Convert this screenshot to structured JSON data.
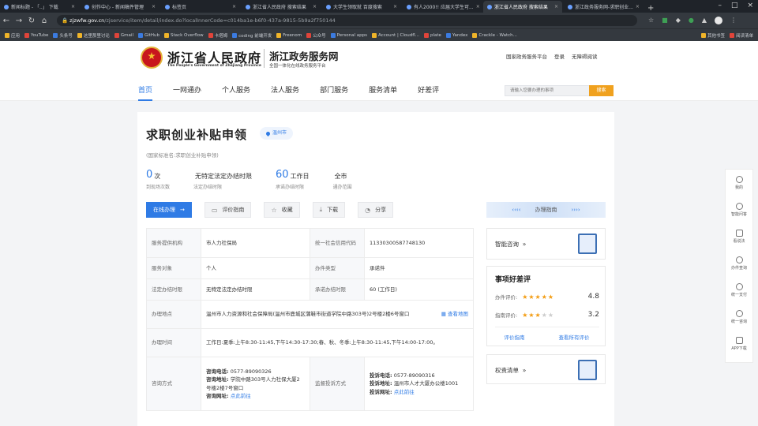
{
  "browser": {
    "tabs": [
      {
        "label": "新闻标题 - 「..」 下载"
      },
      {
        "label": "创作中心 - 新闻稿件管理"
      },
      {
        "label": "标签页"
      },
      {
        "label": "浙江省人民政府 搜索结果"
      },
      {
        "label": "大学生领取就 百度搜索"
      },
      {
        "label": "有人2000!! 应届大学生可..."
      },
      {
        "label": "浙江省人民政府 搜索结果"
      },
      {
        "label": "浙江政务服务网-求职创业..."
      }
    ],
    "active_tab": 6,
    "url_domain": "zjzwfw.gov.cn",
    "url_path": "/zjservice/item/detail/index.do?localInnerCode=c014ba1e-b6f0-437a-9815-5b9a2f750144",
    "bookmarks": [
      "应用",
      "YouTube",
      "头条号",
      "这里那里讨论",
      "Gmail",
      "GitHub",
      "Stack Overflow",
      "卡塔姆",
      "coding 前端开发",
      "Freenom",
      "公众号",
      "Personal apps",
      "Account | Cloudfl...",
      "plate",
      "Yandex",
      "Crackle - Watch..."
    ],
    "bookmarks_right": [
      "其他书签",
      "阅读清单"
    ]
  },
  "header": {
    "gov_title": "浙江省人民政府",
    "gov_en": "The People's Government of Zhejiang Province",
    "service_title": "浙江政务服务网",
    "service_sub": "全国一体化在线政务服务平台",
    "top_links": [
      "国家政务服务平台",
      "登录",
      "无障碍阅读"
    ],
    "nav": [
      "首页",
      "一网通办",
      "个人服务",
      "法人服务",
      "部门服务",
      "服务清单",
      "好差评"
    ],
    "search_placeholder": "请输入您要办理的事项",
    "search_button": "搜索"
  },
  "item": {
    "title": "求职创业补贴申领",
    "location": "温州市",
    "standard_name": "(国家标准名:求职创业补贴申领)",
    "stats": [
      {
        "num": "0",
        "unit": "次",
        "label": "到现场次数"
      },
      {
        "num": "",
        "unit": "无特定法定办结时限",
        "label": "法定办结时限"
      },
      {
        "num": "60",
        "unit": "工作日",
        "label": "承诺办结时限"
      },
      {
        "num": "",
        "unit": "全市",
        "label": "通办范围"
      }
    ],
    "actions": [
      "在线办理",
      "评价指南",
      "收藏",
      "下载",
      "分享"
    ],
    "guide_label": "办理指南"
  },
  "info": {
    "provider_k": "服务提供机构",
    "provider_v": "市人力社保局",
    "credit_k": "统一社会信用代码",
    "credit_v": "11330300587748130",
    "target_k": "服务对象",
    "target_v": "个人",
    "type_k": "办件类型",
    "type_v": "承诺件",
    "legal_k": "法定办结时限",
    "legal_v": "无特定法定办结时限",
    "promise_k": "承诺办结时限",
    "promise_v": "60 (工作日)",
    "place_k": "办理地点",
    "place_v": "温州市人力资源和社会保障局(温州市鹿城区蒲鞋市街道学院中路303号)2号楼2楼6号窗口",
    "map_link": "查看地图",
    "time_k": "办理时间",
    "time_v": "工作日:夏季:上午8:30-11:45,下午14:30-17:30;春、秋、冬季:上午8:30-11:45,下午14:00-17:00。",
    "consult_k": "咨询方式",
    "consult_phone_k": "咨询电话:",
    "consult_phone_v": "0577-89090326",
    "consult_addr_k": "咨询地址:",
    "consult_addr_v": "学院中路303号人力社保大厦2号楼2楼7号窗口",
    "consult_web_k": "咨询网址:",
    "consult_web_v": "点此前往",
    "complain_k": "监督投诉方式",
    "complain_phone_k": "投诉电话:",
    "complain_phone_v": "0577-89090316",
    "complain_addr_k": "投诉地址:",
    "complain_addr_v": "温州市人才大厦办公楼1001",
    "complain_web_k": "投诉网址:",
    "complain_web_v": "点此前往"
  },
  "side": {
    "consult": "智能咨询",
    "rating_title": "事项好差评",
    "ratings": [
      {
        "label": "办件评价:",
        "score": "4.8",
        "stars": 5
      },
      {
        "label": "指南评价:",
        "score": "3.2",
        "stars": 3
      }
    ],
    "rating_links": [
      "评价指南",
      "查看所有评价"
    ],
    "rights": "权责清单"
  },
  "right_rail": [
    "我的",
    "智能问答",
    "看说法",
    "办件查询",
    "统一支付",
    "统一咨询",
    "APP下载"
  ]
}
